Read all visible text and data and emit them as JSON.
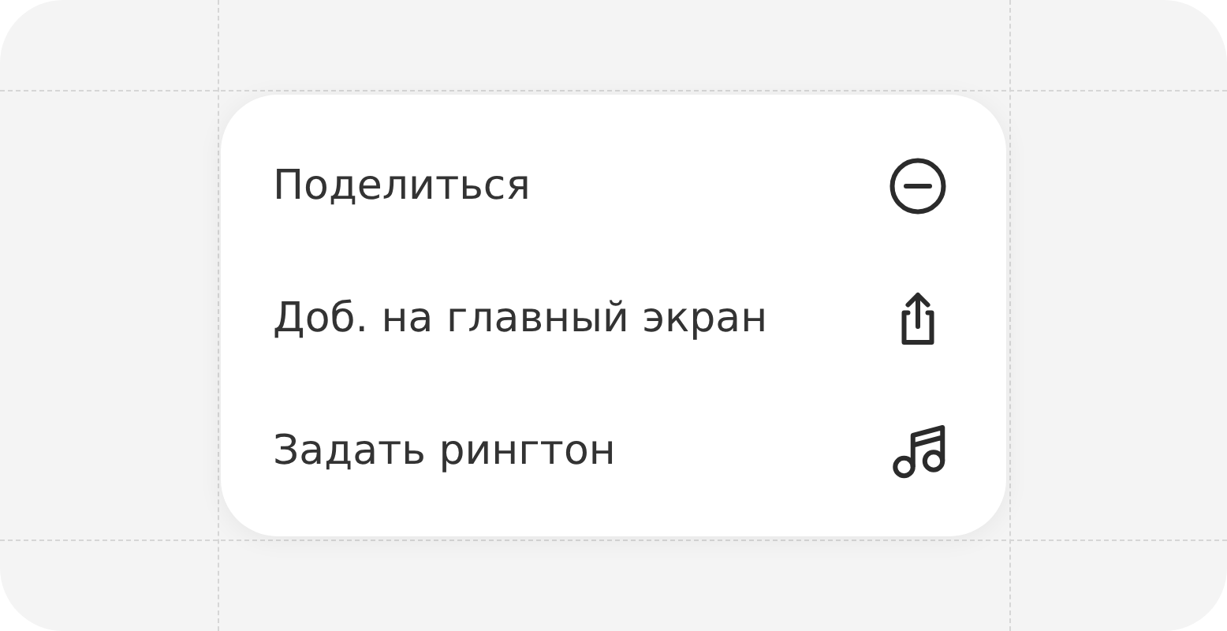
{
  "menu": {
    "items": [
      {
        "label": "Поделиться"
      },
      {
        "label": "Доб. на главный экран"
      },
      {
        "label": "Задать рингтон"
      }
    ]
  }
}
